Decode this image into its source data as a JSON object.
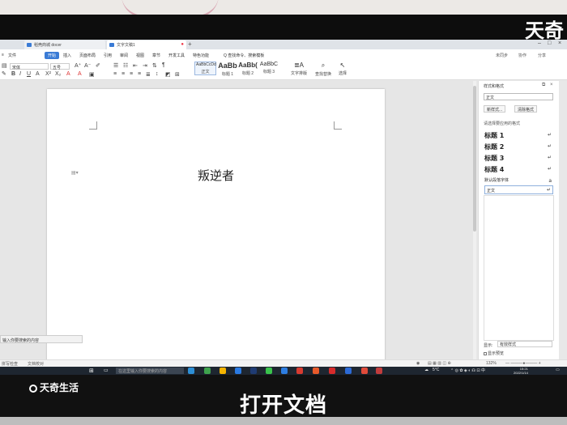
{
  "watermark": {
    "top_right": "天奇",
    "bottom_left": "天奇生活"
  },
  "caption": "打开文档",
  "tabs": [
    {
      "label": "稻壳商城 docer"
    },
    {
      "label": "文字文稿1"
    }
  ],
  "menu": {
    "file": "文件",
    "items": [
      "开始",
      "插入",
      "页面布局",
      "引用",
      "审阅",
      "视图",
      "章节",
      "开发工具",
      "特色功能"
    ],
    "search": "Q 查找命令、搜索模板",
    "right": [
      "未同步",
      "协作",
      "分享"
    ]
  },
  "toolbar": {
    "font_name": "宋体",
    "font_size": "五号",
    "styles": [
      {
        "sample": "AaBbCcDd",
        "label": "正文"
      },
      {
        "sample": "AaBb",
        "label": "标题 1"
      },
      {
        "sample": "AaBb(",
        "label": "标题 2"
      },
      {
        "sample": "AaBbC",
        "label": "标题 3"
      }
    ],
    "text_tools": "文字排版",
    "find_replace": "查找替换",
    "select": "选择"
  },
  "document": {
    "title": "叛逆者"
  },
  "panel": {
    "title": "样式和格式",
    "current_style": "正文",
    "new_style": "新样式...",
    "clear_format": "清除格式",
    "apply_label": "请选择要应用的格式",
    "styles": [
      "标题 1",
      "标题 2",
      "标题 3",
      "标题 4"
    ],
    "default_font": "默认段落字体",
    "body": "正文",
    "show_label": "显示:",
    "show_value": "有效样式",
    "preview_label": "显示预览"
  },
  "statusbar": {
    "left": "拼写检查",
    "mode": "文档校对",
    "zoom": "132%"
  },
  "taskbar": {
    "search_placeholder": "在这里输入你要搜索的内容",
    "weather": "5°C",
    "time": "15:21",
    "date": "2022/1/14",
    "tip": "输入你要搜索的内容"
  }
}
